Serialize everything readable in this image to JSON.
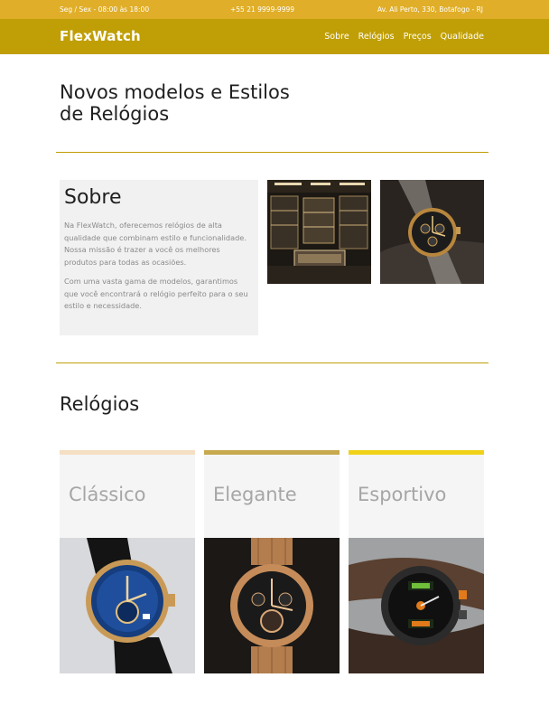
{
  "topbar": {
    "hours": "Seg / Sex - 08:00 às 18:00",
    "phone": "+55 21 9999-9999",
    "address": "Av. Ali Perto, 330, Botafogo - RJ"
  },
  "navbar": {
    "brand": "FlexWatch",
    "links": [
      "Sobre",
      "Relógios",
      "Preços",
      "Qualidade"
    ]
  },
  "hero": {
    "title": "Novos modelos e Estilos de Relógios"
  },
  "about": {
    "title": "Sobre",
    "paragraphs": [
      "Na FlexWatch, oferecemos relógios de alta qualidade que combinam estilo e funcionalidade. Nossa missão é trazer a você os melhores produtos para todas as ocasiões.",
      "Com uma vasta gama de modelos, garantimos que você encontrará o relógio perfeito para o seu estilo e necessidade."
    ]
  },
  "watches": {
    "title": "Relógios",
    "cards": [
      {
        "label": "Clássico",
        "accent": "#f5dfc3"
      },
      {
        "label": "Elegante",
        "accent": "#c7a94e"
      },
      {
        "label": "Esportivo",
        "accent": "#f0d118"
      }
    ]
  },
  "colors": {
    "topbar": "#e0ae28",
    "navbar": "#c09f06",
    "divider": "#c09f06",
    "about_bg": "#f1f1f1"
  }
}
